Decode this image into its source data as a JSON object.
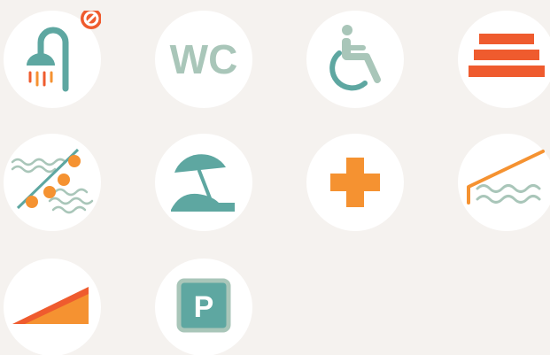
{
  "colors": {
    "teal": "#5ea7a1",
    "orange": "#f59231",
    "red_orange": "#ef5b2e",
    "sage": "#a9c6b9",
    "background": "#f5f2ef",
    "circle": "#ffffff"
  },
  "icons": [
    {
      "name": "shower-not-allowed-icon",
      "badge": "prohibited"
    },
    {
      "name": "wc-icon",
      "label": "WC"
    },
    {
      "name": "wheelchair-accessible-icon"
    },
    {
      "name": "stairs-icon"
    },
    {
      "name": "swim-lane-buoy-rope-icon"
    },
    {
      "name": "beach-umbrella-icon"
    },
    {
      "name": "first-aid-cross-icon"
    },
    {
      "name": "pool-ladder-ramp-icon"
    },
    {
      "name": "ramp-slope-icon"
    },
    {
      "name": "parking-icon",
      "label": "P"
    }
  ]
}
